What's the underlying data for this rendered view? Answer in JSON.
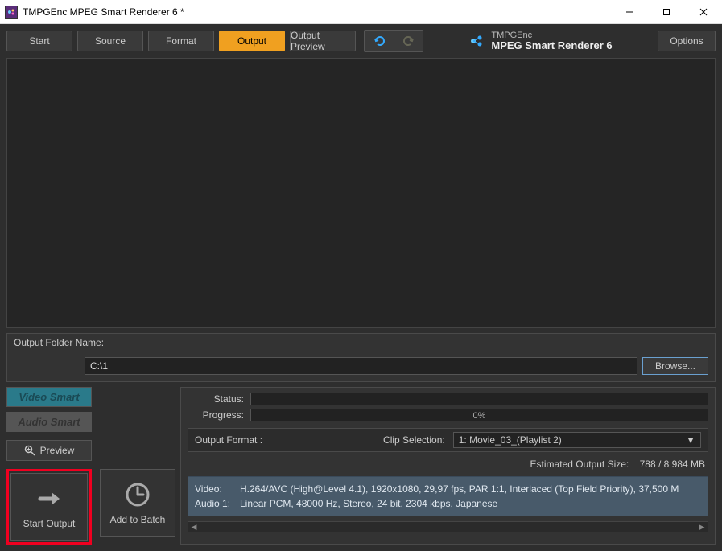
{
  "window": {
    "title": "TMPGEnc MPEG Smart Renderer 6 *"
  },
  "toolbar": {
    "start": "Start",
    "source": "Source",
    "format": "Format",
    "output": "Output",
    "output_preview": "Output Preview",
    "options": "Options"
  },
  "brand": {
    "line1": "TMPGEnc",
    "line2": "MPEG Smart Renderer 6"
  },
  "folder": {
    "label": "Output Folder Name:",
    "path": "C:\\1",
    "browse": "Browse..."
  },
  "badges": {
    "video": "Video Smart",
    "audio": "Audio Smart"
  },
  "preview_btn": "Preview",
  "big_buttons": {
    "start_output": "Start Output",
    "add_to_batch": "Add to Batch"
  },
  "status": {
    "status_label": "Status:",
    "progress_label": "Progress:",
    "progress_pct": "0%"
  },
  "format_row": {
    "output_format_label": "Output Format :",
    "clip_selection_label": "Clip Selection:",
    "clip_value": "1: Movie_03_(Playlist 2)"
  },
  "estimated": {
    "label": "Estimated Output Size:",
    "value": "788 / 8 984 MB"
  },
  "info": {
    "video_label": "Video:",
    "video_value": "H.264/AVC (High@Level 4.1), 1920x1080, 29,97  fps, PAR 1:1, Interlaced (Top Field Priority), 37,500 M",
    "audio_label": "Audio 1:",
    "audio_value": "Linear PCM, 48000  Hz, Stereo, 24 bit, 2304 kbps, Japanese"
  }
}
